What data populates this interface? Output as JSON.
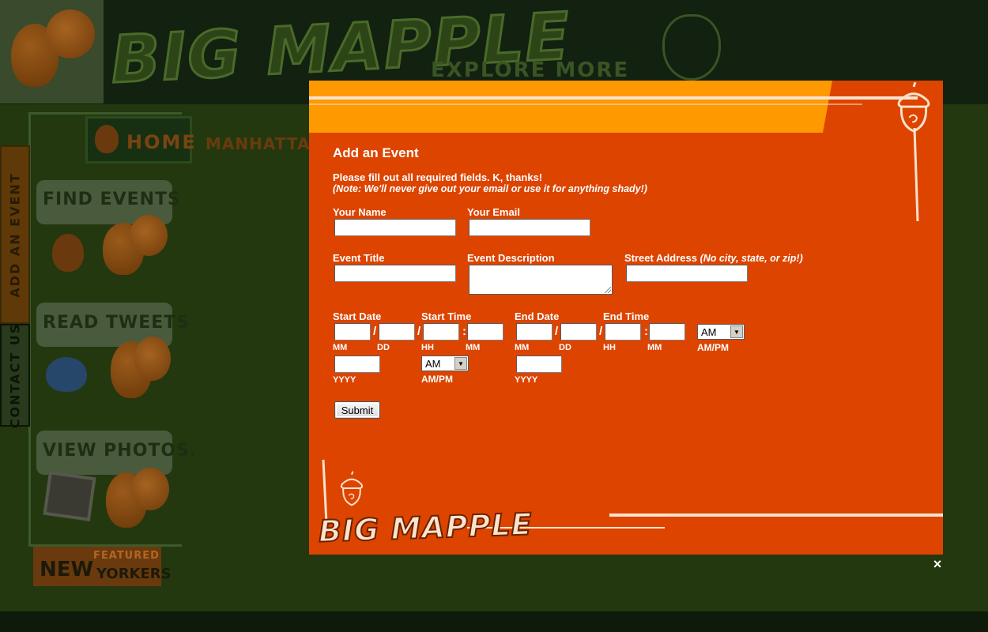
{
  "background": {
    "logo_text": "BIG MAPPLE",
    "tagline": "EXPLORE MORE",
    "nav": {
      "home": "HOME",
      "manhattan": "MANHATTAN"
    },
    "bubbles": [
      {
        "label": "FIND EVENTS"
      },
      {
        "label": "READ TWEETS"
      },
      {
        "label": "VIEW PHOTOS."
      }
    ],
    "side_tabs": {
      "add_event": "ADD AN EVENT",
      "contact": "CONTACT US"
    },
    "featured": {
      "small": "FEATURED",
      "new": "NEW",
      "yorkers": "YORKERS"
    }
  },
  "modal": {
    "title": "Add an Event",
    "intro": "Please fill out all required fields. K, thanks!",
    "note": "(Note: We'll never give out your email or use it for anything shady!)",
    "labels": {
      "name": "Your Name",
      "email": "Your Email",
      "event_title": "Event Title",
      "event_description": "Event Description",
      "street_address": "Street Address",
      "street_address_hint": "(No city, state, or zip!)",
      "start_date": "Start Date",
      "start_time": "Start Time",
      "end_date": "End Date",
      "end_time": "End Time"
    },
    "sublabels": {
      "mm": "MM",
      "dd": "DD",
      "yyyy": "YYYY",
      "hh": "HH",
      "ampm": "AM/PM"
    },
    "separators": {
      "date": "/",
      "time": ":"
    },
    "fields": {
      "name": "",
      "email": "",
      "event_title": "",
      "event_description": "",
      "street_address": "",
      "start_mm": "",
      "start_dd": "",
      "start_yyyy": "",
      "start_hh": "",
      "start_min": "",
      "start_ampm": "AM",
      "end_mm": "",
      "end_dd": "",
      "end_yyyy": "",
      "end_hh": "",
      "end_min": "",
      "end_ampm": "AM"
    },
    "submit_label": "Submit",
    "logo_text": "BIG MAPPLE",
    "close_glyph": "×"
  },
  "colors": {
    "modal_bg": "#dd4400",
    "modal_band": "#ff9900",
    "page_bg": "#23380f"
  },
  "icons": [
    "acorn-icon",
    "squirrel-icon",
    "bird-icon",
    "select-arrow-icon",
    "close-icon"
  ]
}
